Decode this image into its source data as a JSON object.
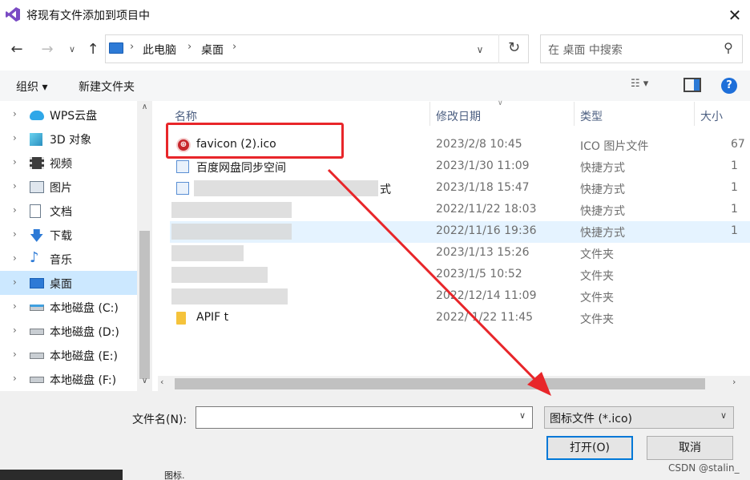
{
  "window": {
    "title": "将现有文件添加到项目中",
    "close_glyph": "✕"
  },
  "address": {
    "crumbs": [
      "此电脑",
      "桌面"
    ],
    "separator": "›",
    "search_placeholder": "在 桌面 中搜索"
  },
  "toolbar": {
    "organize_label": "组织 ▾",
    "new_folder_label": "新建文件夹",
    "help_label": "?"
  },
  "nav": {
    "items": [
      {
        "label": "WPS云盘",
        "icon": "cloud-icon"
      },
      {
        "label": "3D 对象",
        "icon": "cube-icon"
      },
      {
        "label": "视频",
        "icon": "film-icon"
      },
      {
        "label": "图片",
        "icon": "picture-icon"
      },
      {
        "label": "文档",
        "icon": "document-icon"
      },
      {
        "label": "下载",
        "icon": "download-icon"
      },
      {
        "label": "音乐",
        "icon": "music-icon"
      },
      {
        "label": "桌面",
        "icon": "desktop-icon",
        "selected": true
      },
      {
        "label": "本地磁盘 (C:)",
        "icon": "drive-icon"
      },
      {
        "label": "本地磁盘 (D:)",
        "icon": "drive-icon"
      },
      {
        "label": "本地磁盘 (E:)",
        "icon": "drive-icon"
      },
      {
        "label": "本地磁盘 (F:)",
        "icon": "drive-icon"
      }
    ]
  },
  "columns": {
    "name": "名称",
    "date": "修改日期",
    "type": "类型",
    "size": "大小"
  },
  "files": [
    {
      "name": "favicon (2).ico",
      "date": "2023/2/8 10:45",
      "type": "ICO 图片文件",
      "size": "67"
    },
    {
      "name": "百度网盘同步空间",
      "date": "2023/1/30 11:09",
      "type": "快捷方式",
      "size": "1"
    },
    {
      "name": "式",
      "date": "2023/1/18 15:47",
      "type": "快捷方式",
      "size": "1"
    },
    {
      "name": "",
      "date": "2022/11/22 18:03",
      "type": "快捷方式",
      "size": "1"
    },
    {
      "name": "",
      "date": "2022/11/16 19:36",
      "type": "快捷方式",
      "size": "1"
    },
    {
      "name": "",
      "date": "2023/1/13 15:26",
      "type": "文件夹",
      "size": ""
    },
    {
      "name": "",
      "date": "2023/1/5 10:52",
      "type": "文件夹",
      "size": ""
    },
    {
      "name": "",
      "date": "2022/12/14 11:09",
      "type": "文件夹",
      "size": ""
    },
    {
      "name": "APIF          t",
      "date": "2022/ 1/22 11:45",
      "type": "文件夹",
      "size": ""
    }
  ],
  "bottom": {
    "filename_label": "文件名(N):",
    "filename_value": "",
    "filter_label": "图标文件 (*.ico)",
    "open_label": "打开(O)",
    "cancel_label": "取消"
  },
  "watermark": "CSDN @stalin_",
  "bottom_stray_text": "图标.",
  "annotation_color": "#e8262a"
}
